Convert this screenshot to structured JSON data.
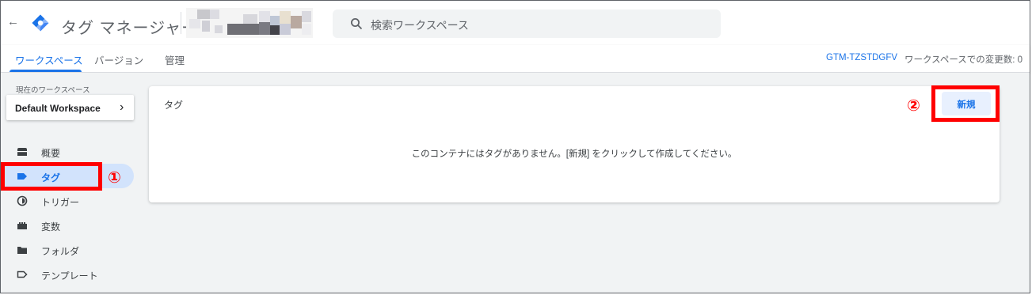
{
  "topbar": {
    "back_icon": "arrow-back-icon",
    "logo_icon": "tag-manager-logo",
    "app_title": "タグ マネージャー",
    "search_placeholder": "検索ワークスペース"
  },
  "tabs": [
    {
      "label": "ワークスペース",
      "active": true
    },
    {
      "label": "バージョン",
      "active": false
    },
    {
      "label": "管理",
      "active": false
    }
  ],
  "status": {
    "container_id": "GTM-TZSTDGFV",
    "changes_label": "ワークスペースでの変更数: 0"
  },
  "sidebar": {
    "workspace_label": "現在のワークスペース",
    "workspace_name": "Default Workspace",
    "items": [
      {
        "label": "概要",
        "icon": "overview-icon",
        "active": false
      },
      {
        "label": "タグ",
        "icon": "tag-icon",
        "active": true
      },
      {
        "label": "トリガー",
        "icon": "trigger-icon",
        "active": false
      },
      {
        "label": "変数",
        "icon": "variables-icon",
        "active": false
      },
      {
        "label": "フォルダ",
        "icon": "folder-icon",
        "active": false
      },
      {
        "label": "テンプレート",
        "icon": "template-icon",
        "active": false
      }
    ]
  },
  "content": {
    "title": "タグ",
    "new_button": "新規",
    "empty_message": "このコンテナにはタグがありません。[新規] をクリックして作成してください。"
  },
  "annotations": [
    {
      "label": "①"
    },
    {
      "label": "②"
    }
  ],
  "colors": {
    "accent": "#1a73e8",
    "annotation": "#ff0000",
    "active_nav": "#d2e3fc"
  }
}
